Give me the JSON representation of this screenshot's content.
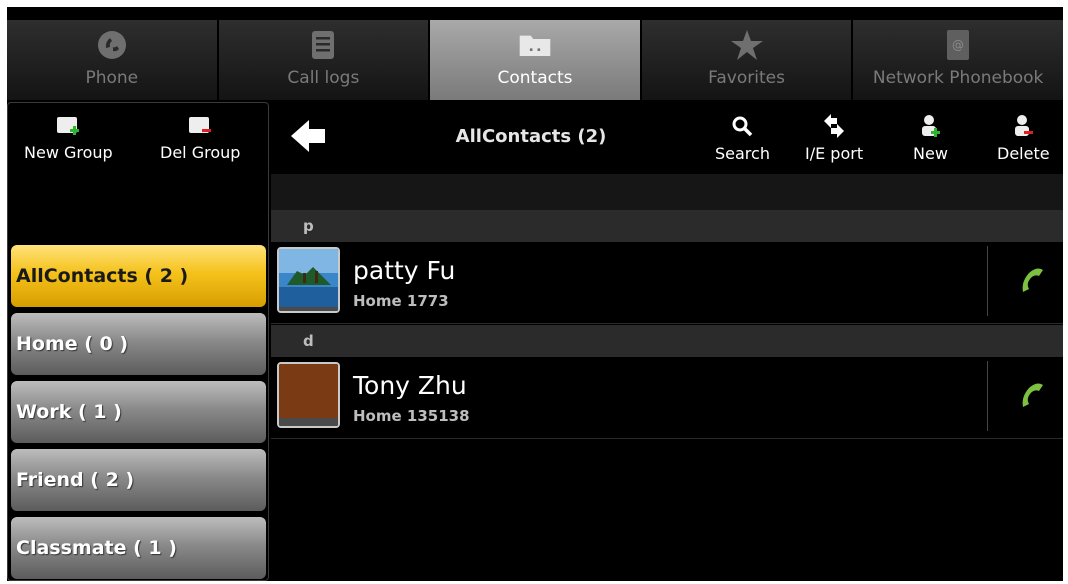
{
  "tabs": [
    {
      "label": "Phone",
      "icon": "phone-icon",
      "active": false
    },
    {
      "label": "Call logs",
      "icon": "call-logs-icon",
      "active": false
    },
    {
      "label": "Contacts",
      "icon": "contacts-icon",
      "active": true
    },
    {
      "label": "Favorites",
      "icon": "star-icon",
      "active": false
    },
    {
      "label": "Network Phonebook",
      "icon": "network-phonebook-icon",
      "active": false
    }
  ],
  "sidebar": {
    "new_group_label": "New Group",
    "del_group_label": "Del Group",
    "groups": [
      {
        "label": "AllContacts ( 2 )",
        "active": true
      },
      {
        "label": "Home ( 0 )",
        "active": false
      },
      {
        "label": "Work ( 1 )",
        "active": false
      },
      {
        "label": "Friend ( 2 )",
        "active": false
      },
      {
        "label": "Classmate ( 1 )",
        "active": false
      }
    ]
  },
  "toolbar": {
    "title": "AllContacts (2)",
    "search_label": "Search",
    "ieport_label": "I/E port",
    "new_label": "New",
    "delete_label": "Delete"
  },
  "contacts": [
    {
      "section": "p",
      "name": "patty Fu",
      "number": "Home 1773",
      "avatar": "landscape-photo"
    },
    {
      "section": "d",
      "name": "Tony Zhu",
      "number": "Home 135138",
      "avatar": "brown-placeholder"
    }
  ],
  "colors": {
    "active_group": "#f5c21b",
    "call_icon": "#7dc142",
    "active_tab": "#9a9a9a"
  }
}
